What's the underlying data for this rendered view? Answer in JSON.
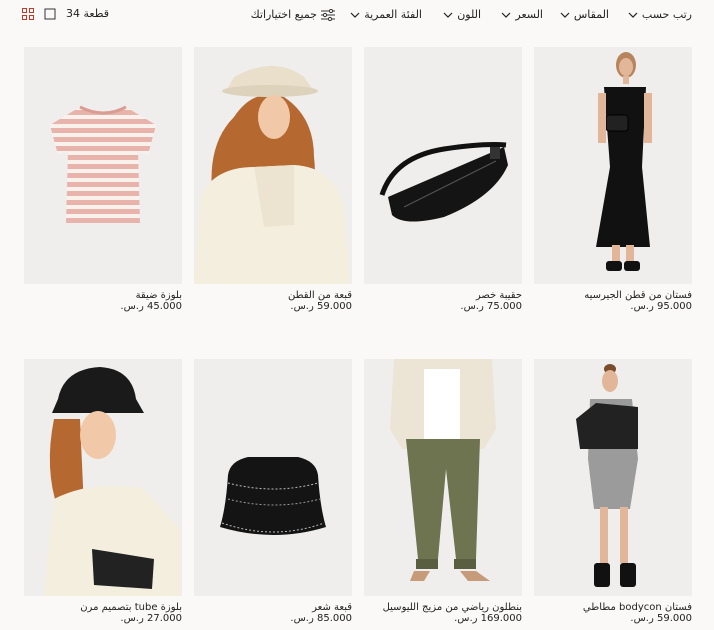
{
  "filters": {
    "sort": "رتب حسب",
    "size": "المقاس",
    "price": "السعر",
    "color": "اللون",
    "age": "الفئة العمرية",
    "all": "جميع اختياراتك"
  },
  "count": "34 قطعة",
  "products": [
    {
      "name": "فستان من قطن الجيرسيه",
      "price": "95.000 ر.س."
    },
    {
      "name": "حقيبة خصر",
      "price": "75.000 ر.س."
    },
    {
      "name": "قبعة من القطن",
      "price": "59.000 ر.س."
    },
    {
      "name": "بلوزة ضيقة",
      "price": "45.000 ر.س."
    },
    {
      "name": "فستان bodycon مطاطي",
      "price": "59.000 ر.س."
    },
    {
      "name": "بنطلون رياضي من مزيج الليوسيل",
      "price": "169.000 ر.س."
    },
    {
      "name": "قبعة شعر",
      "price": "85.000 ر.س."
    },
    {
      "name": "بلوزة tube بتصميم مرن",
      "price": "27.000 ر.س."
    }
  ]
}
